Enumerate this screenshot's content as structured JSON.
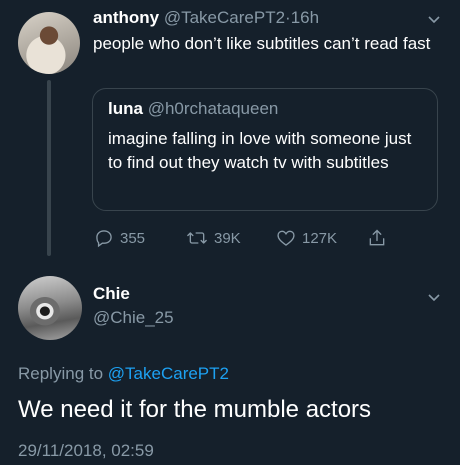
{
  "tweet": {
    "author_name": "anthony",
    "author_handle": "@TakeCarePT2",
    "separator": "·",
    "time": "16h",
    "text": "people who don’t like subtitles can’t read fast",
    "quoted": {
      "author_name": "luna",
      "author_handle": "@h0rchataqueen",
      "text": "imagine falling in love with someone just to find out they watch tv with subtitles"
    },
    "stats": {
      "replies": "355",
      "retweets": "39K",
      "likes": "127K"
    }
  },
  "reply": {
    "author_name": "Chie",
    "author_handle": "@Chie_25",
    "replying_prefix": "Replying to",
    "replying_to": "@TakeCarePT2",
    "text": "We need it for the mumble actors",
    "timestamp": "29/11/2018, 02:59"
  },
  "colors": {
    "background": "#15202b",
    "muted": "#8899a6",
    "link": "#1da1f2",
    "border": "#38444d"
  },
  "icons": [
    "reply-icon",
    "retweet-icon",
    "like-icon",
    "share-icon",
    "chevron-down-icon"
  ]
}
